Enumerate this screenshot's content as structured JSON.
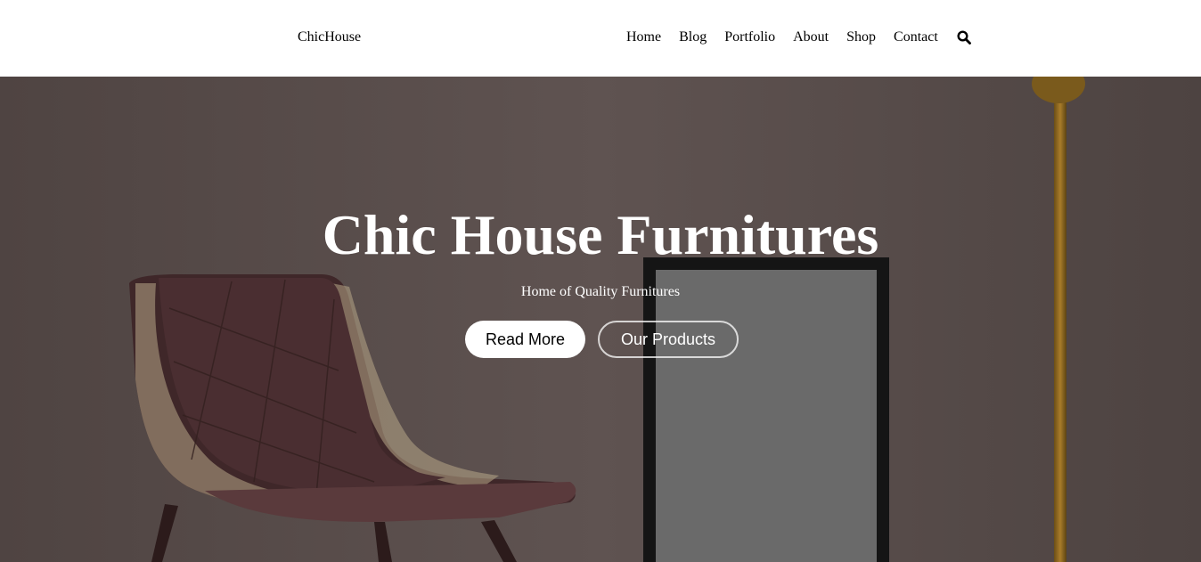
{
  "header": {
    "logo": "ChicHouse",
    "nav": [
      "Home",
      "Blog",
      "Portfolio",
      "About",
      "Shop",
      "Contact"
    ],
    "search_icon": "search-icon"
  },
  "hero": {
    "title": "Chic House Furnitures",
    "subtitle": "Home of Quality Furnitures",
    "primary_button": "Read More",
    "secondary_button": "Our Products"
  },
  "colors": {
    "header_bg": "#ffffff",
    "hero_overlay": "#5d504e",
    "text_light": "#ffffff"
  }
}
